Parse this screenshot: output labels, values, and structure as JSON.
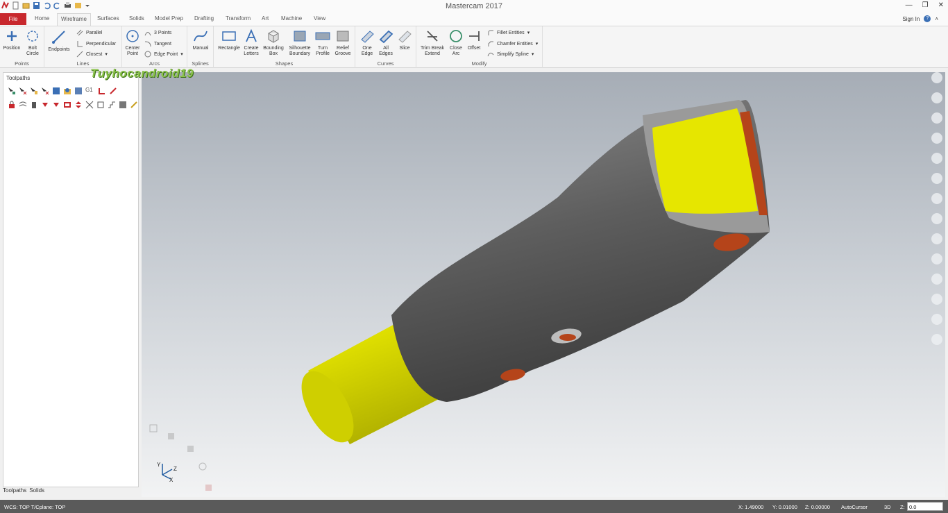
{
  "window": {
    "title": "Mastercam 2017"
  },
  "tabs": {
    "file": "File",
    "items": [
      "Home",
      "Wireframe",
      "Surfaces",
      "Solids",
      "Model Prep",
      "Drafting",
      "Transform",
      "Art",
      "Machine",
      "View"
    ],
    "active": "Wireframe"
  },
  "account": {
    "sign_in": "Sign In",
    "help": "?"
  },
  "ribbon": {
    "points": {
      "label": "Points",
      "position": "Position",
      "bolt_circle_1": "Bolt",
      "bolt_circle_2": "Circle"
    },
    "lines": {
      "label": "Lines",
      "endpoints": "Endpoints",
      "parallel": "Parallel",
      "perpendicular": "Perpendicular",
      "closest": "Closest"
    },
    "arcs": {
      "label": "Arcs",
      "center_point_1": "Center",
      "center_point_2": "Point",
      "three_points": "3 Points",
      "tangent": "Tangent",
      "edge_point": "Edge Point"
    },
    "splines": {
      "label": "Splines",
      "manual": "Manual"
    },
    "shapes": {
      "label": "Shapes",
      "rectangle": "Rectangle",
      "create_letters_1": "Create",
      "create_letters_2": "Letters",
      "bounding_box_1": "Bounding",
      "bounding_box_2": "Box",
      "silhouette_1": "Silhouette",
      "silhouette_2": "Boundary",
      "turn_profile_1": "Turn",
      "turn_profile_2": "Profile",
      "relief_groove_1": "Relief",
      "relief_groove_2": "Groove"
    },
    "curves": {
      "label": "Curves",
      "one_edge_1": "One",
      "one_edge_2": "Edge",
      "all_edges_1": "All",
      "all_edges_2": "Edges",
      "slice": "Slice"
    },
    "modify": {
      "label": "Modify",
      "trim_1": "Trim Break",
      "trim_2": "Extend",
      "close_arc_1": "Close",
      "close_arc_2": "Arc",
      "offset": "Offset",
      "fillet": "Fillet Entities",
      "chamfer": "Chamfer Entities",
      "simplify": "Simplify Spline"
    }
  },
  "panel": {
    "title": "Toolpaths",
    "bottom_tabs": [
      "Toolpaths",
      "Solids"
    ],
    "g1": "G1"
  },
  "watermark": "Tuyhocandroid19",
  "viewport": {
    "triad_z": "Z",
    "triad_y": "Y",
    "triad_x": "X"
  },
  "status": {
    "wcs": "WCS: TOP T/Cplane: TOP",
    "x": "X: 1.49000",
    "y": "Y: 0.01000",
    "z": "Z: 0.00000",
    "autocursor": "AutoCursor",
    "mode": "3D",
    "z_label": "Z:",
    "z_value": "0.0"
  },
  "colors": {
    "file_tab": "#c8282d",
    "part_body": "#6b6b6b",
    "face_yellow": "#e6e600",
    "hole": "#b5441a"
  }
}
